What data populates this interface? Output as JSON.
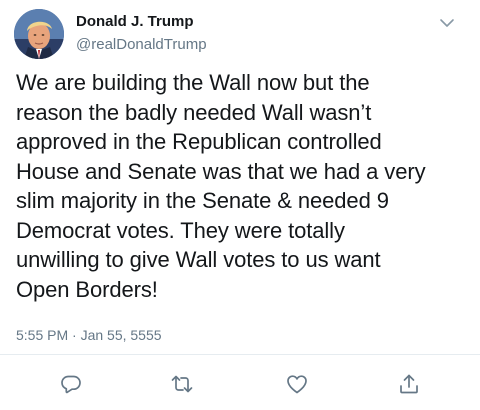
{
  "tweet": {
    "display_name": "Donald J. Trump",
    "handle": "@realDonaldTrump",
    "text_lines": [
      "We are building the Wall now but the",
      "reason the badly needed Wall wasn’t",
      "approved in the Republican controlled",
      "House and Senate was that we had a very",
      "slim majority in the Senate & needed 9",
      "Democrat votes. They were totally",
      "unwilling to give Wall votes to us want",
      "Open Borders!"
    ],
    "timestamp": "5:55 PM · Jan 55, 5555"
  },
  "icons": {
    "menu": "chevron-down-icon",
    "reply": "reply-icon",
    "retweet": "retweet-icon",
    "like": "heart-icon",
    "share": "share-icon"
  },
  "colors": {
    "text": "#14171a",
    "secondary": "#657786",
    "icon": "#657786",
    "divider": "#e6ecf0"
  }
}
